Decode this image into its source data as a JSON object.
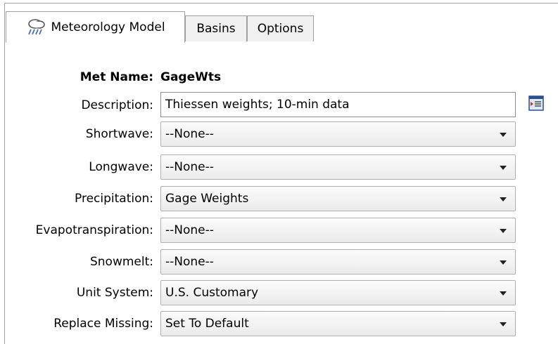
{
  "tabs": [
    {
      "label": "Meteorology Model",
      "icon": "cloud-rain-icon",
      "active": true
    },
    {
      "label": "Basins",
      "active": false
    },
    {
      "label": "Options",
      "active": false
    }
  ],
  "form": {
    "met_name_label": "Met Name:",
    "met_name_value": "GageWts",
    "description_label": "Description:",
    "description_value": "Thiessen weights; 10-min data",
    "description_button_icon": "edit-description-icon",
    "shortwave_label": "Shortwave:",
    "shortwave_value": "--None--",
    "longwave_label": "Longwave:",
    "longwave_value": "--None--",
    "precipitation_label": "Precipitation:",
    "precipitation_value": "Gage Weights",
    "evapotranspiration_label": "Evapotranspiration:",
    "evapotranspiration_value": "--None--",
    "snowmelt_label": "Snowmelt:",
    "snowmelt_value": "--None--",
    "unit_system_label": "Unit System:",
    "unit_system_value": "U.S. Customary",
    "replace_missing_label": "Replace Missing:",
    "replace_missing_value": "Set To Default"
  },
  "colors": {
    "border": "#a0a0a0",
    "tab_inactive_bg": "#f0f0f0",
    "combo_bg": "#ebebeb"
  }
}
